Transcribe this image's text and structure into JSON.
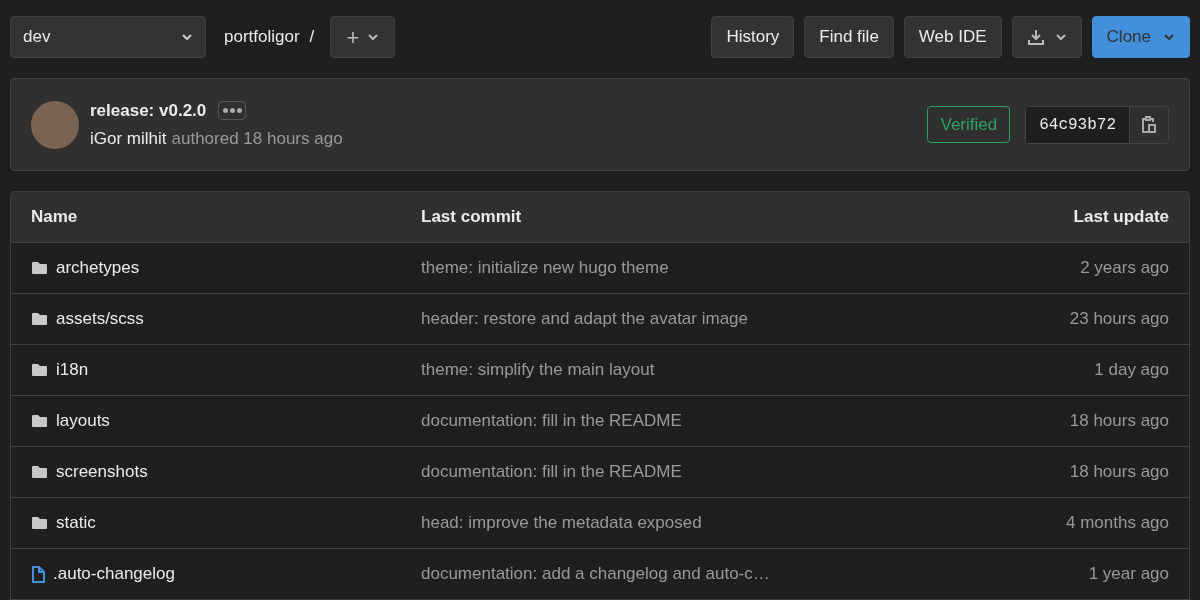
{
  "branch": {
    "value": "dev"
  },
  "breadcrumb": {
    "project": "portfoligor",
    "separator": "/"
  },
  "add_menu": {
    "icon": "+"
  },
  "actions": [
    {
      "label": "History",
      "kind": "plain"
    },
    {
      "label": "Find file",
      "kind": "plain"
    },
    {
      "label": "Web IDE",
      "kind": "plain"
    },
    {
      "kind": "download"
    },
    {
      "label": "Clone",
      "kind": "primary"
    }
  ],
  "commit": {
    "title": "release: v0.2.0",
    "author": "iGor milhit",
    "meta": "authored 18 hours ago",
    "badge": "Verified",
    "sha": "64c93b72"
  },
  "table": {
    "columns": [
      "Name",
      "Last commit",
      "Last update"
    ],
    "rows": [
      {
        "kind": "folder",
        "name": "archetypes",
        "commit": "theme: initialize new hugo theme",
        "updated": "2 years ago"
      },
      {
        "kind": "folder",
        "name": "assets/scss",
        "commit": "header: restore and adapt the avatar image",
        "updated": "23 hours ago"
      },
      {
        "kind": "folder",
        "name": "i18n",
        "commit": "theme: simplify the main layout",
        "updated": "1 day ago"
      },
      {
        "kind": "folder",
        "name": "layouts",
        "commit": "documentation: fill in the README",
        "updated": "18 hours ago"
      },
      {
        "kind": "folder",
        "name": "screenshots",
        "commit": "documentation: fill in the README",
        "updated": "18 hours ago"
      },
      {
        "kind": "folder",
        "name": "static",
        "commit": "head: improve the metadata exposed",
        "updated": "4 months ago"
      },
      {
        "kind": "file",
        "name": ".auto-changelog",
        "commit": "documentation: add a changelog and auto-c…",
        "updated": "1 year ago"
      }
    ]
  }
}
